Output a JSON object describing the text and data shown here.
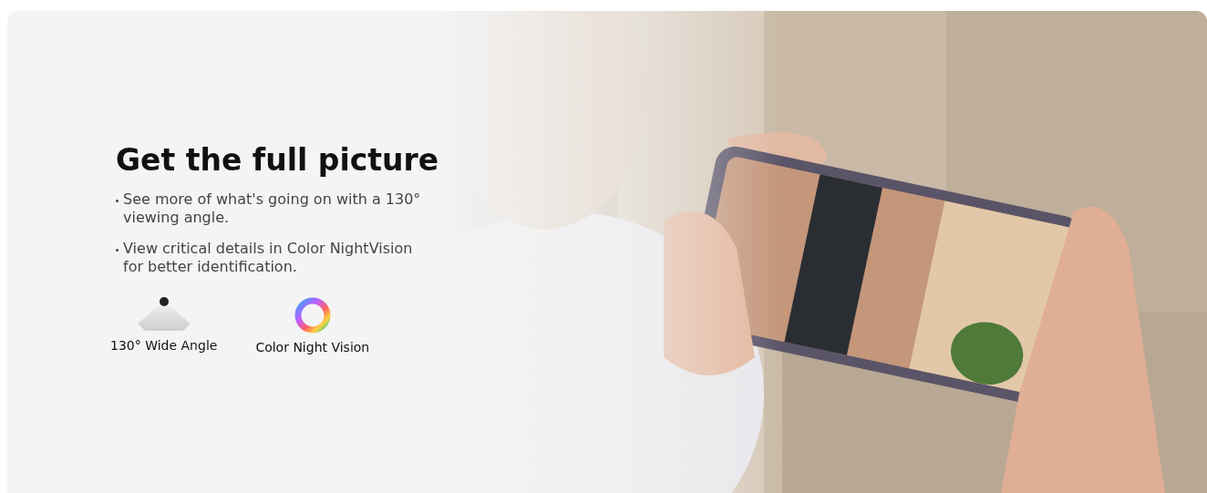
{
  "heading": "Get the full picture",
  "bullets": [
    "See more of what's going on with a 130° viewing angle.",
    "View critical details in Color NightVision for better identification."
  ],
  "features": [
    {
      "kind": "wide-angle",
      "label": "130° Wide Angle"
    },
    {
      "kind": "color-ring",
      "label": "Color Night Vision"
    }
  ]
}
